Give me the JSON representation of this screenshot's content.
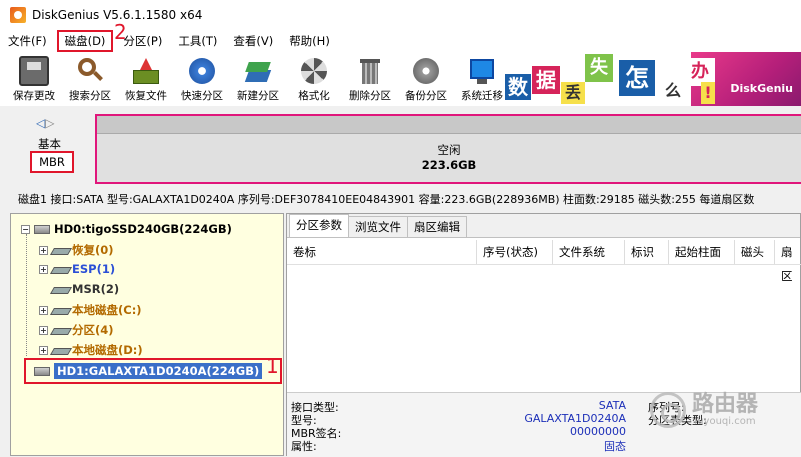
{
  "window": {
    "title": "DiskGenius V5.6.1.1580 x64"
  },
  "menu": [
    "文件(F)",
    "磁盘(D)",
    "分区(P)",
    "工具(T)",
    "查看(V)",
    "帮助(H)"
  ],
  "annotations": {
    "one": "1",
    "two": "2"
  },
  "toolbar": [
    {
      "label": "保存更改",
      "icon": "save-icon"
    },
    {
      "label": "搜索分区",
      "icon": "magnifier-icon"
    },
    {
      "label": "恢复文件",
      "icon": "restore-icon"
    },
    {
      "label": "快速分区",
      "icon": "quick-partition-icon"
    },
    {
      "label": "新建分区",
      "icon": "new-partition-icon"
    },
    {
      "label": "格式化",
      "icon": "format-icon"
    },
    {
      "label": "删除分区",
      "icon": "delete-icon"
    },
    {
      "label": "备份分区",
      "icon": "backup-icon"
    },
    {
      "label": "系统迁移",
      "icon": "migrate-icon"
    }
  ],
  "banner": {
    "chars": [
      "数",
      "据",
      "丢",
      "失",
      "怎",
      "么",
      "办",
      "!"
    ],
    "brand": "DiskGeniu"
  },
  "disk_map": {
    "type_label": "基本",
    "scheme": "MBR",
    "free_label": "空闲",
    "free_size": "223.6GB"
  },
  "disk_info": "磁盘1 接口:SATA  型号:GALAXTA1D0240A  序列号:DEF3078410EE04843901  容量:223.6GB(228936MB)  柱面数:29185  磁头数:255  每道扇区数",
  "tree": {
    "hd0": "HD0:tigoSSD240GB(224GB)",
    "partitions": [
      {
        "label": "恢复(0)",
        "color": "#b36a00"
      },
      {
        "label": "ESP(1)",
        "color": "#2b4fd6"
      },
      {
        "label": "MSR(2)",
        "color": "#333333"
      },
      {
        "label": "本地磁盘(C:)",
        "color": "#b36a00"
      },
      {
        "label": "分区(4)",
        "color": "#b36a00"
      },
      {
        "label": "本地磁盘(D:)",
        "color": "#b36a00"
      }
    ],
    "hd1": "HD1:GALAXTA1D0240A(224GB)"
  },
  "tabs": [
    "分区参数",
    "浏览文件",
    "扇区编辑"
  ],
  "columns": [
    "卷标",
    "序号(状态)",
    "文件系统",
    "标识",
    "起始柱面",
    "磁头",
    "扇区"
  ],
  "details": {
    "interface_label": "接口类型:",
    "interface_value": "SATA",
    "model_label": "型号:",
    "model_value": "GALAXTA1D0240A",
    "mbr_label": "MBR签名:",
    "mbr_value": "00000000",
    "attr_label": "属性:",
    "attr_value": "固态",
    "serial_label": "序列号:",
    "ptype_label": "分区表类型:"
  },
  "watermark": {
    "name": "路由器",
    "site": "luyouqi.com"
  }
}
